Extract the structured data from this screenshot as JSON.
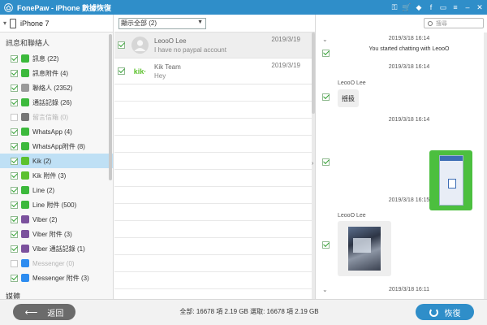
{
  "titlebar": {
    "title": "FonePaw - iPhone 數據恢復",
    "icons": [
      "key-icon",
      "cart-icon",
      "diamond-icon",
      "facebook-icon",
      "chat-icon",
      "menu-icon",
      "minimize-icon",
      "close-icon"
    ]
  },
  "sidebar": {
    "device_name": "iPhone 7",
    "section_title": "訊息和聯絡人",
    "section2_title": "媒體",
    "items": [
      {
        "label": "訊息 (22)",
        "checked": true,
        "disabled": false,
        "icon_color": "#3cb93c"
      },
      {
        "label": "訊息附件 (4)",
        "checked": true,
        "disabled": false,
        "icon_color": "#3cb93c"
      },
      {
        "label": "聯絡人 (2352)",
        "checked": true,
        "disabled": false,
        "icon_color": "#9a9a9a"
      },
      {
        "label": "通話記錄 (26)",
        "checked": true,
        "disabled": false,
        "icon_color": "#3cb93c"
      },
      {
        "label": "留言信箱 (0)",
        "checked": false,
        "disabled": true,
        "icon_color": "#777777"
      },
      {
        "label": "WhatsApp (4)",
        "checked": true,
        "disabled": false,
        "icon_color": "#3cb93c"
      },
      {
        "label": "WhatsApp附件 (8)",
        "checked": true,
        "disabled": false,
        "icon_color": "#3cb93c"
      },
      {
        "label": "Kik (2)",
        "checked": true,
        "disabled": false,
        "icon_color": "#5dc12e"
      },
      {
        "label": "Kik 附件 (3)",
        "checked": true,
        "disabled": false,
        "icon_color": "#5dc12e"
      },
      {
        "label": "Line (2)",
        "checked": true,
        "disabled": false,
        "icon_color": "#3cb93c"
      },
      {
        "label": "Line 附件 (500)",
        "checked": true,
        "disabled": false,
        "icon_color": "#3cb93c"
      },
      {
        "label": "Viber (2)",
        "checked": true,
        "disabled": false,
        "icon_color": "#7b519d"
      },
      {
        "label": "Viber 附件 (3)",
        "checked": true,
        "disabled": false,
        "icon_color": "#7b519d"
      },
      {
        "label": "Viber 通話記錄 (1)",
        "checked": true,
        "disabled": false,
        "icon_color": "#7b519d"
      },
      {
        "label": "Messenger (0)",
        "checked": false,
        "disabled": true,
        "icon_color": "#2d8cf0"
      },
      {
        "label": "Messenger 附件 (3)",
        "checked": true,
        "disabled": false,
        "icon_color": "#2d8cf0"
      }
    ],
    "selected_index": 7
  },
  "middle": {
    "filter_value": "顯示全部 (2)",
    "conversations": [
      {
        "name": "LeooO Lee",
        "message": "I have no paypal account",
        "date": "2019/3/19",
        "avatar": "person-avatar"
      },
      {
        "name": "Kik Team",
        "message": "Hey",
        "date": "2019/3/19",
        "avatar": "kik-logo"
      }
    ]
  },
  "chat": {
    "search_placeholder": "搜尋",
    "ts1": "2019/3/18 16:14",
    "sys1": "You started chatting with LeooO",
    "ts2": "2019/3/18 16:14",
    "sender1": "LeooO Lee",
    "bubble1": "揺扱",
    "ts3": "2019/3/18 16:14",
    "ts4": "2019/3/18 16:15",
    "sender2": "LeooO Lee",
    "ts5": "2019/3/18 16:11"
  },
  "bottom": {
    "back_label": "返回",
    "status": "全部: 16678 項 2.19 GB 選取: 16678 項 2.19 GB",
    "recover_label": "恢復"
  }
}
